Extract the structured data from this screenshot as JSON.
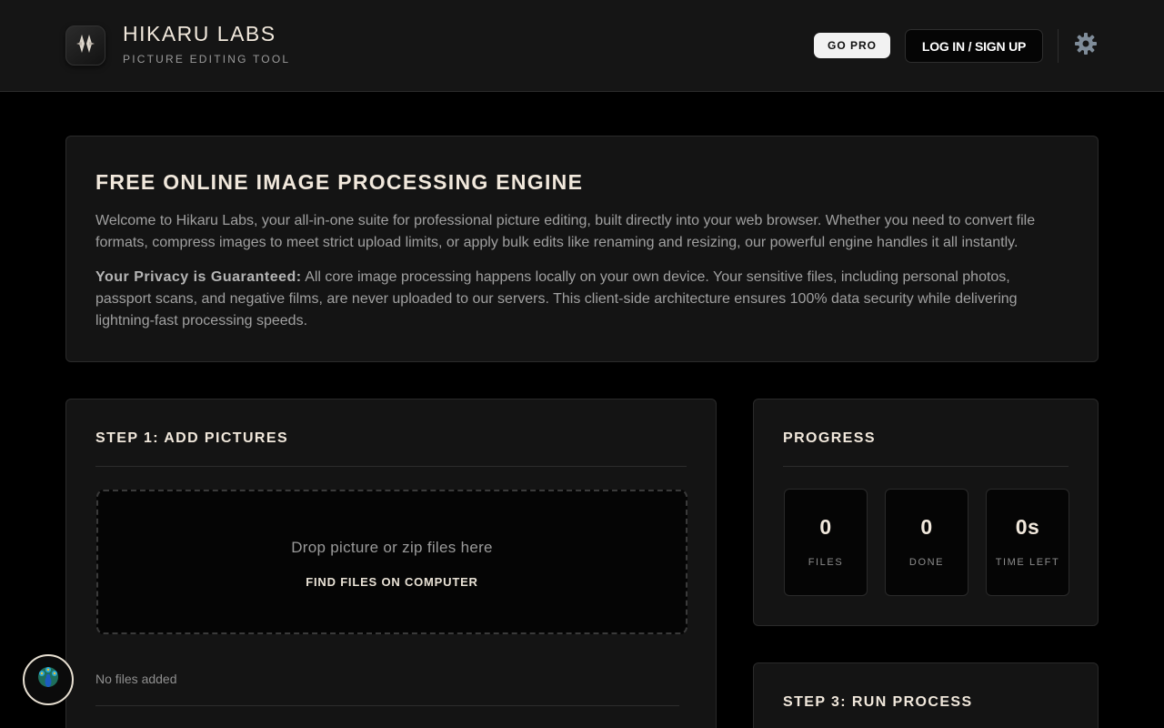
{
  "header": {
    "brand_title": "HIKARU LABS",
    "brand_subtitle": "PICTURE EDITING TOOL",
    "go_pro_label": "GO PRO",
    "login_label": "LOG IN / SIGN UP",
    "logo_icon": "diamond-sparkle-icon",
    "settings_icon": "gear-icon"
  },
  "intro": {
    "title": "FREE ONLINE IMAGE PROCESSING ENGINE",
    "paragraph1": "Welcome to Hikaru Labs, your all-in-one suite for professional picture editing, built directly into your web browser. Whether you need to convert file formats, compress images to meet strict upload limits, or apply bulk edits like renaming and resizing, our powerful engine handles it all instantly.",
    "privacy_label": "Your Privacy is Guaranteed:",
    "paragraph2": " All core image processing happens locally on your own device. Your sensitive files, including personal photos, passport scans, and negative films, are never uploaded to our servers. This client-side architecture ensures 100% data security while delivering lightning-fast processing speeds."
  },
  "step1": {
    "title": "STEP 1: ADD PICTURES",
    "dropzone_text": "Drop picture or zip files here",
    "find_files_label": "FIND FILES ON COMPUTER",
    "empty_text": "No files added"
  },
  "progress": {
    "title": "PROGRESS",
    "stats": [
      {
        "value": "0",
        "label": "FILES"
      },
      {
        "value": "0",
        "label": "DONE"
      },
      {
        "value": "0s",
        "label": "TIME LEFT"
      }
    ]
  },
  "step3": {
    "title": "STEP 3: RUN PROCESS"
  },
  "fab": {
    "icon": "peacock-icon"
  },
  "colors": {
    "background": "#000000",
    "card": "#141414",
    "heading": "#f1e8dc",
    "muted_text": "#a0a0a0"
  }
}
